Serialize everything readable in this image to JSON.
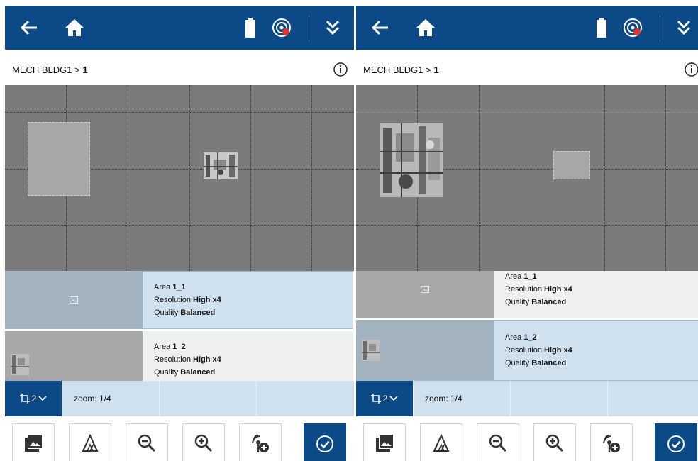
{
  "screens": [
    {
      "breadcrumb": {
        "prefix": "MECH BLDG1 >",
        "level": "1"
      },
      "areas": [
        {
          "name_prefix": "Area ",
          "name_value": "1_1",
          "resolution_label": "Resolution ",
          "resolution_value": "High x4",
          "quality_label": "Quality ",
          "quality_value": "Balanced",
          "selected": true
        },
        {
          "name_prefix": "Area ",
          "name_value": "1_2",
          "resolution_label": "Resolution ",
          "resolution_value": "High x4",
          "quality_label": "Quality ",
          "quality_value": "Balanced",
          "selected": false
        }
      ],
      "layers_count": "2",
      "zoom": "zoom: 1/4"
    },
    {
      "breadcrumb": {
        "prefix": "MECH BLDG1 >",
        "level": "1"
      },
      "areas": [
        {
          "name_prefix": "Area ",
          "name_value": "1_1",
          "resolution_label": "Resolution ",
          "resolution_value": "High x4",
          "quality_label": "Quality ",
          "quality_value": "Balanced",
          "selected": false
        },
        {
          "name_prefix": "Area ",
          "name_value": "1_2",
          "resolution_label": "Resolution ",
          "resolution_value": "High x4",
          "quality_label": "Quality ",
          "quality_value": "Balanced",
          "selected": true
        }
      ],
      "layers_count": "2",
      "zoom": "zoom: 1/4"
    }
  ],
  "icons": {
    "topbar": [
      "back-arrow-icon",
      "home-icon",
      "battery-icon",
      "scan-target-icon",
      "double-chevron-down-icon"
    ],
    "toolbar": [
      "image-gallery-icon",
      "triangle-layers-icon",
      "zoom-out-icon",
      "zoom-in-icon",
      "add-scan-location-icon",
      "confirm-check-icon"
    ]
  },
  "colors": {
    "header_blue": "#0b4a86",
    "selected_card": "#cfe0ef",
    "unselected_card": "#eef0f2",
    "map_gray": "#7b7b7b"
  }
}
